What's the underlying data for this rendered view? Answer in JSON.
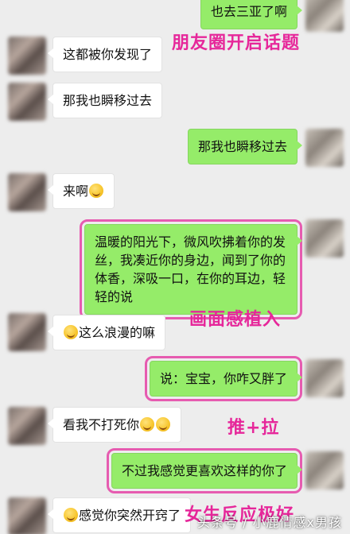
{
  "messages": [
    {
      "side": "right",
      "text": "也去三亚了啊"
    },
    {
      "side": "left",
      "text": "这都被你发现了"
    },
    {
      "side": "left",
      "text": "那我也瞬移过去"
    },
    {
      "side": "right",
      "text": "那我也瞬移过去"
    },
    {
      "side": "left",
      "text": "来啊",
      "emoji": "smile-emoji"
    },
    {
      "side": "right",
      "text": "温暖的阳光下，微风吹拂着你的发丝，我凑近你的身边，闻到了你的体香，深吸一口，在你的耳边，轻轻的说"
    },
    {
      "side": "left",
      "text": "这么浪漫的嘛",
      "emoji": "smile-emoji"
    },
    {
      "side": "right",
      "text": "说：宝宝，你咋又胖了"
    },
    {
      "side": "left",
      "text": "看我不打死你",
      "emoji": "tongue-emoji"
    },
    {
      "side": "right",
      "text": "不过我感觉更喜欢这样的你了"
    },
    {
      "side": "left",
      "text": "感觉你突然开窍了",
      "emoji": "smile-emoji"
    }
  ],
  "annotations": {
    "a1": "朋友圈开启话题",
    "a2": "画面感植入",
    "a3": "推+拉",
    "a4": "女生反应极好"
  },
  "watermark": "头条号 / 小鹿情感x男孩",
  "colors": {
    "background": "#ededed",
    "bubble_right": "#95ec69",
    "bubble_left": "#ffffff",
    "annotation": "#e6279a",
    "highlight_border": "#e65bb0"
  }
}
